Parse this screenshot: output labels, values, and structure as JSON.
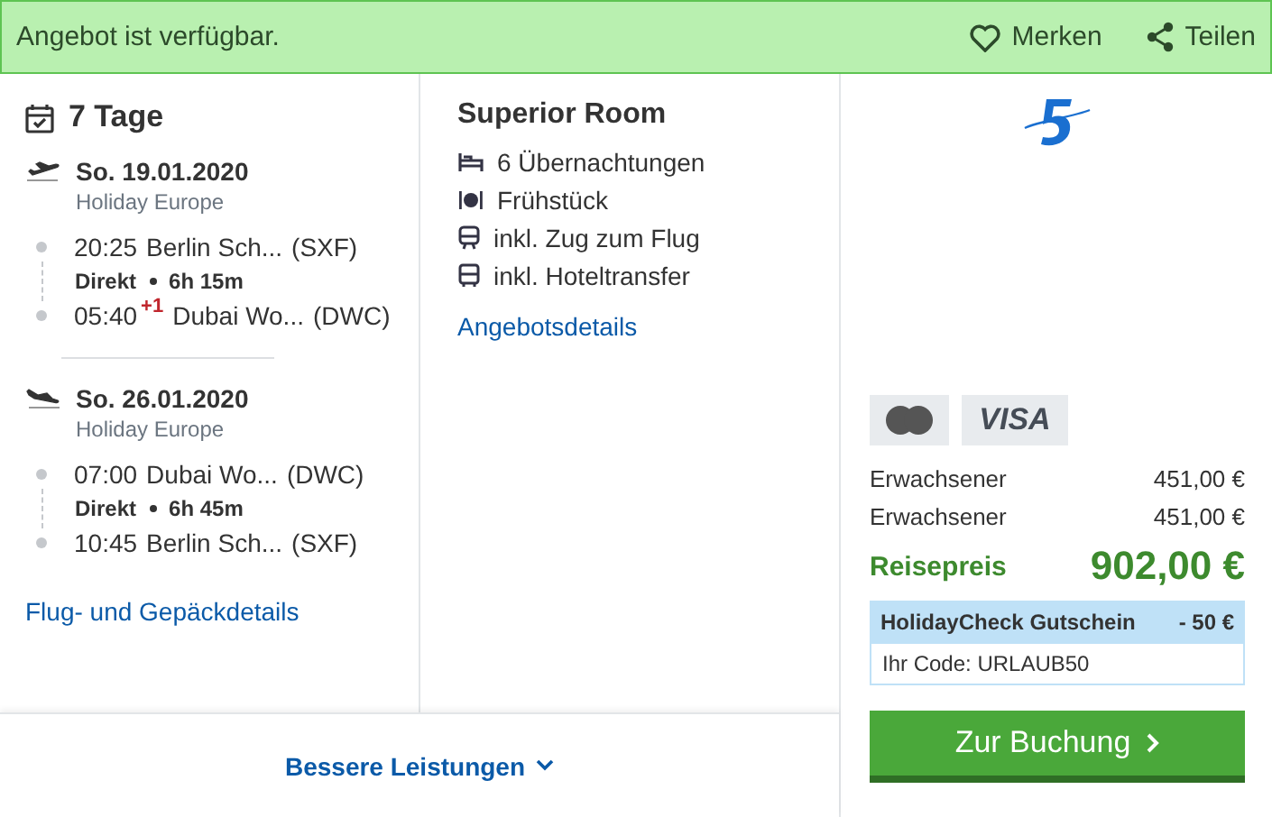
{
  "banner": {
    "text": "Angebot ist verfügbar.",
    "actions": [
      {
        "kind": "heart",
        "label": "Merken"
      },
      {
        "kind": "share",
        "label": "Teilen"
      }
    ]
  },
  "duration": "7 Tage",
  "flights": [
    {
      "kind": "outbound",
      "date": "So. 19.01.2020",
      "airline": "Holiday Europe",
      "departure": {
        "time": "20:25",
        "place": "Berlin Sch...",
        "code": "(SXF)"
      },
      "stops": "Direkt",
      "duration": "6h 15m",
      "arrival": {
        "time": "05:40",
        "day_offset": "+1",
        "place": "Dubai Wo...",
        "code": "(DWC)"
      }
    },
    {
      "kind": "return",
      "date": "So. 26.01.2020",
      "airline": "Holiday Europe",
      "departure": {
        "time": "07:00",
        "place": "Dubai Wo...",
        "code": "(DWC)"
      },
      "stops": "Direkt",
      "duration": "6h 45m",
      "arrival": {
        "time": "10:45",
        "place": "Berlin Sch...",
        "code": "(SXF)"
      }
    }
  ],
  "flight_link": "Flug- und Gepäckdetails",
  "room": {
    "title": "Superior Room",
    "features": [
      {
        "kind": "bed",
        "text": "6 Übernachtungen"
      },
      {
        "kind": "meal",
        "text": "Frühstück"
      },
      {
        "kind": "train",
        "text": "inkl. Zug zum Flug"
      },
      {
        "kind": "bus",
        "text": "inkl. Hoteltransfer"
      }
    ],
    "link": "Angebotsdetails"
  },
  "more_link": "Bessere Leistungen",
  "payment_cards": [
    {
      "kind": "mastercard"
    },
    {
      "kind": "visa",
      "label": "VISA"
    }
  ],
  "prices": [
    {
      "label": "Erwachsener",
      "amount": "451,00 €"
    },
    {
      "label": "Erwachsener",
      "amount": "451,00 €"
    }
  ],
  "total": {
    "label": "Reisepreis",
    "amount": "902,00 €"
  },
  "voucher": {
    "title": "HolidayCheck Gutschein",
    "discount": "- 50 €",
    "code": "Ihr Code: URLAUB50"
  },
  "book_button": "Zur Buchung"
}
